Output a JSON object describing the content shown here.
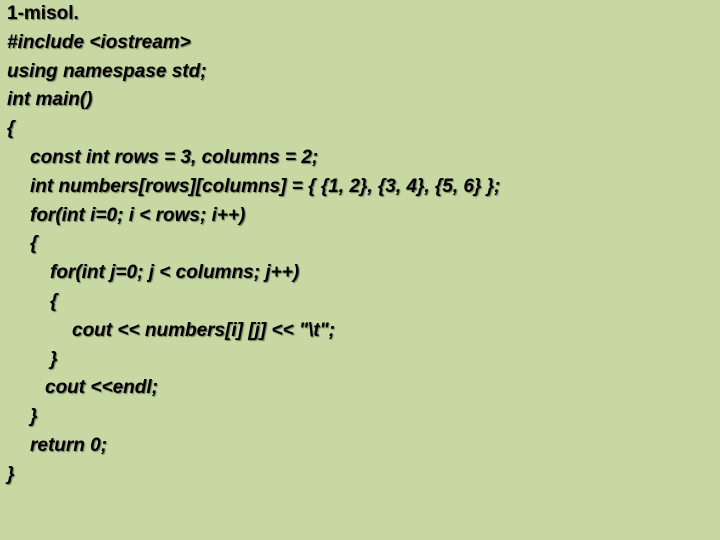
{
  "slide": {
    "title": "1-misol.",
    "code_lines": [
      "#include <iostream>",
      "using namespase std;",
      "int main()",
      "{",
      "const int rows = 3, columns = 2;",
      "int numbers[rows][columns] = { {1, 2}, {3, 4}, {5, 6} };",
      "for(int i=0; i < rows; i++)",
      "{",
      "for(int j=0; j < columns; j++)",
      "{",
      "cout << numbers[i] [j] << \"\\t\";",
      "}",
      "cout <<endl;",
      "}",
      "return 0;",
      "}"
    ]
  },
  "colors": {
    "background": "#c8d8a3",
    "text": "#000000"
  }
}
